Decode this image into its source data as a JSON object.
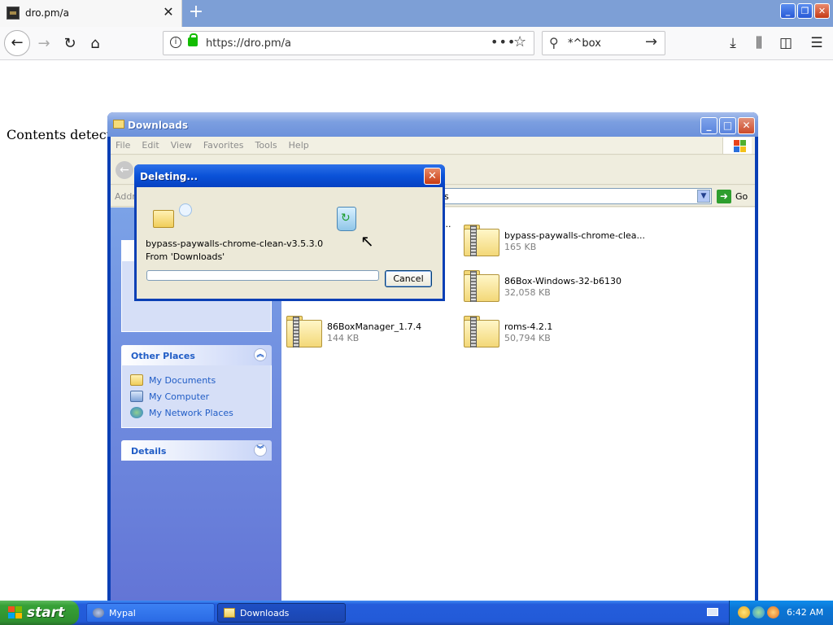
{
  "browser": {
    "tab_title": "dro.pm/a",
    "tab_close": "✕",
    "new_tab": "+",
    "url": "https://dro.pm/a",
    "search_text": "*^box",
    "url_more": "•••"
  },
  "page": {
    "text": "Contents detected"
  },
  "explorer": {
    "title": "Downloads",
    "menu": [
      "File",
      "Edit",
      "View",
      "Favorites",
      "Tools",
      "Help"
    ],
    "address_label": "Addr",
    "address_text": "s",
    "go_label": "Go",
    "other_places": {
      "title": "Other Places",
      "links": [
        "My Documents",
        "My Computer",
        "My Network Places"
      ]
    },
    "details_title": "Details",
    "files": [
      {
        "name": "bypass-paywalls-chrome-clea...",
        "size": "165 KB"
      },
      {
        "name": "86Box-Windows-32-b6130",
        "size": "32,058 KB"
      },
      {
        "name": "86BoxManager_1.7.4",
        "size": "144 KB"
      },
      {
        "name": "roms-4.2.1",
        "size": "50,794 KB"
      }
    ],
    "partial_file_name": "..."
  },
  "dialog": {
    "title": "Deleting...",
    "filename": "bypass-paywalls-chrome-clean-v3.5.3.0",
    "from": "From 'Downloads'",
    "cancel": "Cancel",
    "progress": 0
  },
  "taskbar": {
    "start": "start",
    "items": [
      "Mypal",
      "Downloads"
    ],
    "time": "6:42 AM"
  },
  "colors": {
    "xp_blue": "#0a3fb5",
    "task_link": "#215dc6",
    "start_green": "#37a137"
  }
}
